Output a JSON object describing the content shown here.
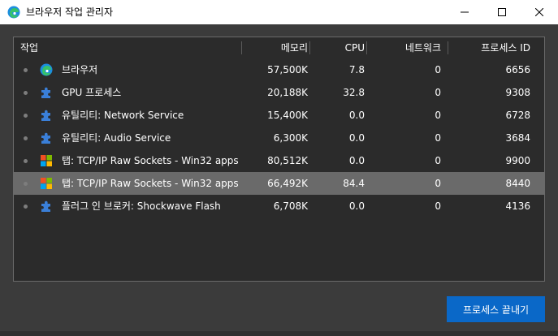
{
  "window": {
    "title": "브라우저 작업 관리자",
    "controls": {
      "minimize_icon": "minimize-icon",
      "maximize_icon": "maximize-icon",
      "close_icon": "close-icon"
    }
  },
  "table": {
    "columns": {
      "task": "작업",
      "memory": "메모리",
      "cpu": "CPU",
      "network": "네트워크",
      "pid": "프로세스 ID"
    },
    "rows": [
      {
        "icon": "edge-icon",
        "name": "브라우저",
        "memory": "57,500K",
        "cpu": "7.8",
        "network": "0",
        "pid": "6656",
        "selected": false
      },
      {
        "icon": "puzzle-icon",
        "name": "GPU 프로세스",
        "memory": "20,188K",
        "cpu": "32.8",
        "network": "0",
        "pid": "9308",
        "selected": false
      },
      {
        "icon": "puzzle-icon",
        "name": "유틸리티: Network Service",
        "memory": "15,400K",
        "cpu": "0.0",
        "network": "0",
        "pid": "6728",
        "selected": false
      },
      {
        "icon": "puzzle-icon",
        "name": "유틸리티: Audio Service",
        "memory": "6,300K",
        "cpu": "0.0",
        "network": "0",
        "pid": "3684",
        "selected": false
      },
      {
        "icon": "windows-logo-icon",
        "name": "탭: TCP/IP Raw Sockets - Win32 apps |...",
        "memory": "80,512K",
        "cpu": "0.0",
        "network": "0",
        "pid": "9900",
        "selected": false
      },
      {
        "icon": "windows-logo-icon",
        "name": "탭: TCP/IP Raw Sockets - Win32 apps |...",
        "memory": "66,492K",
        "cpu": "84.4",
        "network": "0",
        "pid": "8440",
        "selected": true
      },
      {
        "icon": "puzzle-icon",
        "name": "플러그 인 브로커: Shockwave Flash",
        "memory": "6,708K",
        "cpu": "0.0",
        "network": "0",
        "pid": "4136",
        "selected": false
      }
    ]
  },
  "actions": {
    "end_process": "프로세스 끝내기"
  },
  "colors": {
    "accent": "#0a68c8",
    "selected_row": "#6a6a6a",
    "panel_bg": "#2b2b2b",
    "window_bg": "#3b3b3b",
    "puzzle": "#3a7fd8"
  }
}
